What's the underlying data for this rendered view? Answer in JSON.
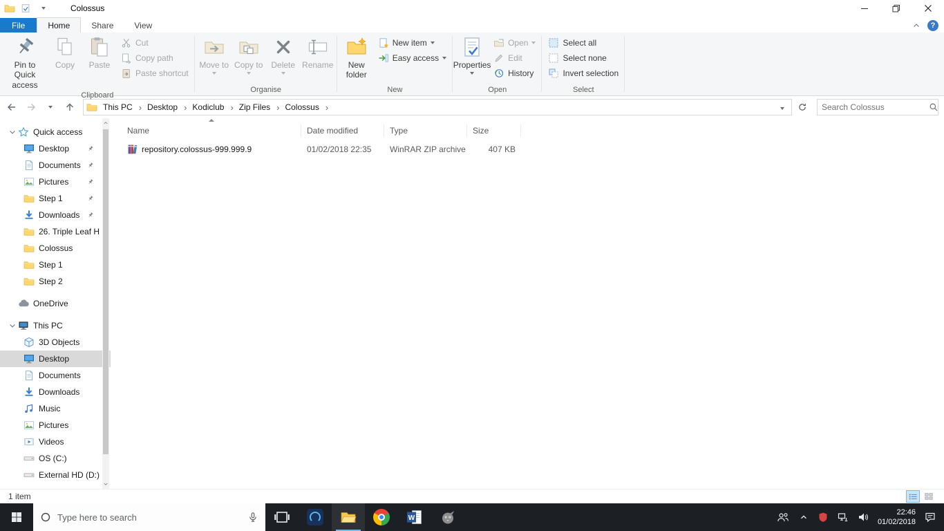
{
  "colors": {
    "accent": "#0078d7",
    "file_tab_blue": "#1979ca",
    "taskbar_bg": "#1c1f24",
    "sidebar_selection": "#d9d9d9"
  },
  "titlebar": {
    "title": "Colossus"
  },
  "ribbon": {
    "tabs": [
      "File",
      "Home",
      "Share",
      "View"
    ],
    "clipboard": {
      "label": "Clipboard",
      "pin": {
        "label": "Pin to Quick access",
        "enabled": true
      },
      "copy": {
        "label": "Copy",
        "enabled": false
      },
      "paste": {
        "label": "Paste",
        "enabled": false
      },
      "cut": {
        "label": "Cut",
        "enabled": false
      },
      "copy_path": {
        "label": "Copy path",
        "enabled": false
      },
      "paste_shortcut": {
        "label": "Paste shortcut",
        "enabled": false
      }
    },
    "organise": {
      "label": "Organise",
      "move_to": {
        "label": "Move to",
        "enabled": false
      },
      "copy_to": {
        "label": "Copy to",
        "enabled": false
      },
      "delete": {
        "label": "Delete",
        "enabled": false
      },
      "rename": {
        "label": "Rename",
        "enabled": false
      }
    },
    "new_group": {
      "label": "New",
      "new_folder": {
        "label": "New folder",
        "enabled": true
      },
      "new_item": {
        "label": "New item",
        "enabled": true
      },
      "easy_access": {
        "label": "Easy access",
        "enabled": true
      }
    },
    "open_group": {
      "label": "Open",
      "properties": {
        "label": "Properties",
        "enabled": true
      },
      "open": {
        "label": "Open",
        "enabled": false
      },
      "edit": {
        "label": "Edit",
        "enabled": false
      },
      "history": {
        "label": "History",
        "enabled": true
      }
    },
    "select_group": {
      "label": "Select",
      "select_all": {
        "label": "Select all",
        "enabled": true
      },
      "select_none": {
        "label": "Select none",
        "enabled": true
      },
      "invert": {
        "label": "Invert selection",
        "enabled": true
      }
    }
  },
  "address": {
    "crumbs": [
      "This PC",
      "Desktop",
      "Kodiclub",
      "Zip Files",
      "Colossus"
    ],
    "search_placeholder": "Search Colossus"
  },
  "sidebar": {
    "quick_access": {
      "label": "Quick access",
      "items": [
        {
          "label": "Desktop",
          "pinned": true
        },
        {
          "label": "Documents",
          "pinned": true
        },
        {
          "label": "Pictures",
          "pinned": true
        },
        {
          "label": "Step 1",
          "pinned": true
        },
        {
          "label": "Downloads",
          "pinned": true
        },
        {
          "label": "26. Triple Leaf H",
          "pinned": false
        },
        {
          "label": "Colossus",
          "pinned": false
        },
        {
          "label": "Step 1",
          "pinned": false
        },
        {
          "label": "Step 2",
          "pinned": false
        }
      ]
    },
    "onedrive": {
      "label": "OneDrive"
    },
    "this_pc": {
      "label": "This PC",
      "items": [
        {
          "label": "3D Objects",
          "selected": false
        },
        {
          "label": "Desktop",
          "selected": true
        },
        {
          "label": "Documents",
          "selected": false
        },
        {
          "label": "Downloads",
          "selected": false
        },
        {
          "label": "Music",
          "selected": false
        },
        {
          "label": "Pictures",
          "selected": false
        },
        {
          "label": "Videos",
          "selected": false
        },
        {
          "label": "OS (C:)",
          "selected": false
        },
        {
          "label": "External HD (D:)",
          "selected": false
        }
      ]
    }
  },
  "files": {
    "columns": [
      "Name",
      "Date modified",
      "Type",
      "Size"
    ],
    "sort": {
      "column": "Name",
      "direction": "ascending"
    },
    "rows": [
      {
        "name": "repository.colossus-999.999.9",
        "date_modified": "01/02/2018 22:35",
        "type": "WinRAR ZIP archive",
        "size": "407 KB"
      }
    ]
  },
  "statusbar": {
    "items_count": "1 item"
  },
  "taskbar": {
    "search_placeholder": "Type here to search",
    "clock": {
      "time": "22:46",
      "date": "01/02/2018"
    }
  }
}
